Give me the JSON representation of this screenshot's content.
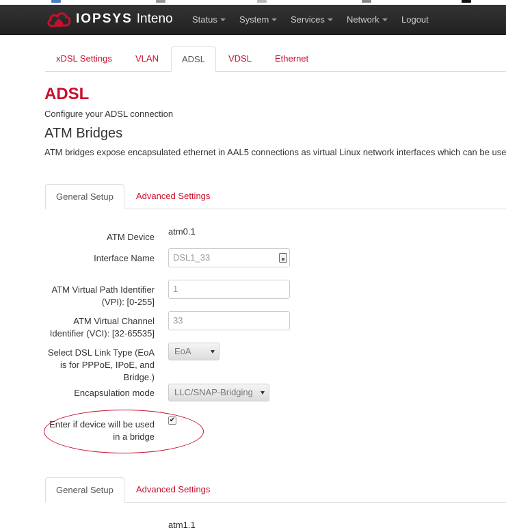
{
  "brand": {
    "word": "IOPSYS",
    "name": "Inteno",
    "logo_color": "#c8102e"
  },
  "nav": [
    {
      "label": "Status"
    },
    {
      "label": "System"
    },
    {
      "label": "Services"
    },
    {
      "label": "Network"
    },
    {
      "label": "Logout"
    }
  ],
  "top_tabs": [
    {
      "label": "xDSL Settings"
    },
    {
      "label": "VLAN"
    },
    {
      "label": "ADSL"
    },
    {
      "label": "VDSL"
    },
    {
      "label": "Ethernet"
    }
  ],
  "active_top_tab": "ADSL",
  "page": {
    "title": "ADSL",
    "description": "Configure your ADSL connection",
    "section_title": "ATM Bridges",
    "section_description": "ATM bridges expose encapsulated ethernet in AAL5 connections as virtual Linux network interfaces which can be use"
  },
  "sub_tabs": [
    {
      "label": "General Setup"
    },
    {
      "label": "Advanced Settings"
    }
  ],
  "form": {
    "atm_device_label": "ATM Device",
    "atm_device_value": "atm0.1",
    "interface_name_label": "Interface Name",
    "interface_name_value": "DSL1_33",
    "vpi_label": "ATM Virtual Path Identifier (VPI): [0-255]",
    "vpi_value": "1",
    "vci_label": "ATM Virtual Channel Identifier (VCI): [32-65535]",
    "vci_value": "33",
    "link_type_label": "Select DSL Link Type (EoA is for PPPoE, IPoE, and Bridge.)",
    "link_type_value": "EoA",
    "encapsulation_label": "Encapsulation mode",
    "encapsulation_value": "LLC/SNAP-Bridging",
    "bridge_label": "Enter if device will be used in a bridge",
    "bridge_checked": true
  },
  "second_block": {
    "atm_device_value": "atm1.1"
  },
  "colors": {
    "accent": "#c8102e",
    "navbar": "#222222"
  }
}
